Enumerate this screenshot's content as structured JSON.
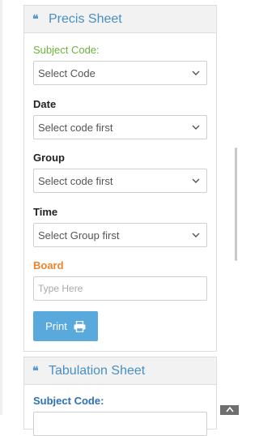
{
  "precis": {
    "title": "Precis Sheet",
    "subject_label": "Subject Code:",
    "subject_value": "Select Code",
    "date_label": "Date",
    "date_value": "Select code first",
    "group_label": "Group",
    "group_value": "Select code first",
    "time_label": "Time",
    "time_value": "Select Group first",
    "board_label": "Board",
    "board_placeholder": "Type Here",
    "print_label": "Print"
  },
  "tabulation": {
    "title": "Tabulation Sheet",
    "subject_label": "Subject Code:"
  },
  "icons": {
    "header_icon": "quote-icon",
    "print_icon": "printer-icon",
    "select_icon": "chevron-down-icon",
    "scroll_top_icon": "chevron-up-icon"
  },
  "colors": {
    "accent_blue": "#4a8fc4",
    "button_blue": "#5aa9dd",
    "subject_green": "#6cb33e",
    "board_orange": "#f0822a"
  }
}
